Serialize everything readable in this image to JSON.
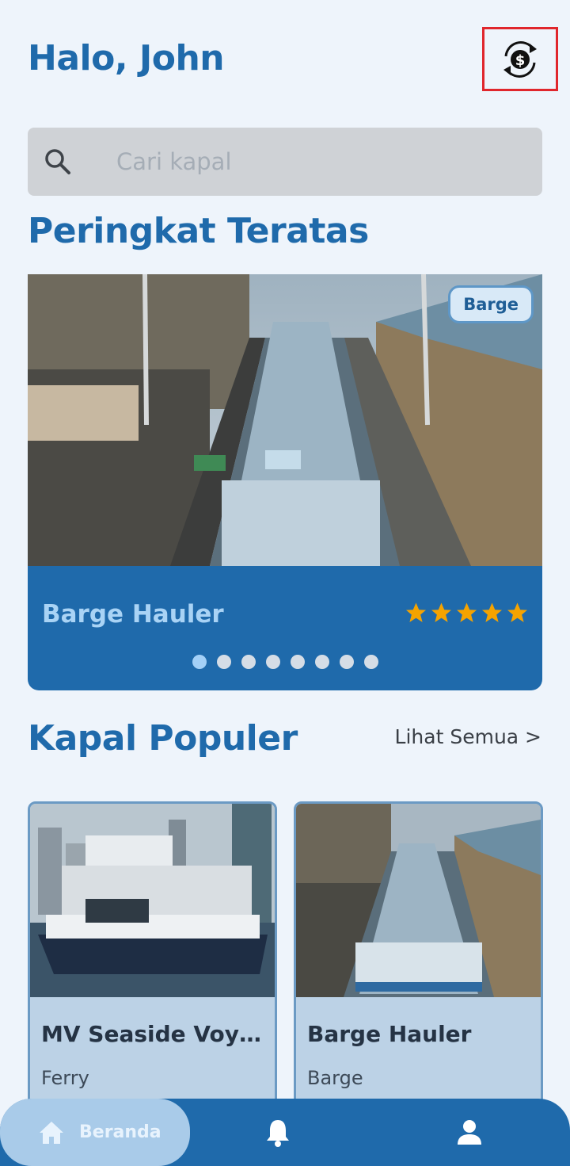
{
  "header": {
    "greeting": "Halo, John",
    "currency_icon": "currency-exchange-icon"
  },
  "search": {
    "placeholder": "Cari kapal",
    "value": ""
  },
  "top_ranked": {
    "title": "Peringkat Teratas",
    "ship": {
      "name": "Barge Hauler",
      "type": "Barge",
      "rating": 5,
      "max_rating": 5
    },
    "slides_total": 8,
    "active_slide": 1
  },
  "popular": {
    "title": "Kapal Populer",
    "see_all": "Lihat Semua >",
    "cards": [
      {
        "name": "MV Seaside Voyager",
        "type": "Ferry"
      },
      {
        "name": "Barge Hauler",
        "type": "Barge"
      }
    ]
  },
  "nav": {
    "home_label": "Beranda",
    "home_icon": "home-icon",
    "notifications_icon": "bell-icon",
    "profile_icon": "user-icon"
  },
  "colors": {
    "primary": "#1f6aab",
    "background": "#eef4fb",
    "star": "#f5a300",
    "highlight": "#e0262c"
  }
}
